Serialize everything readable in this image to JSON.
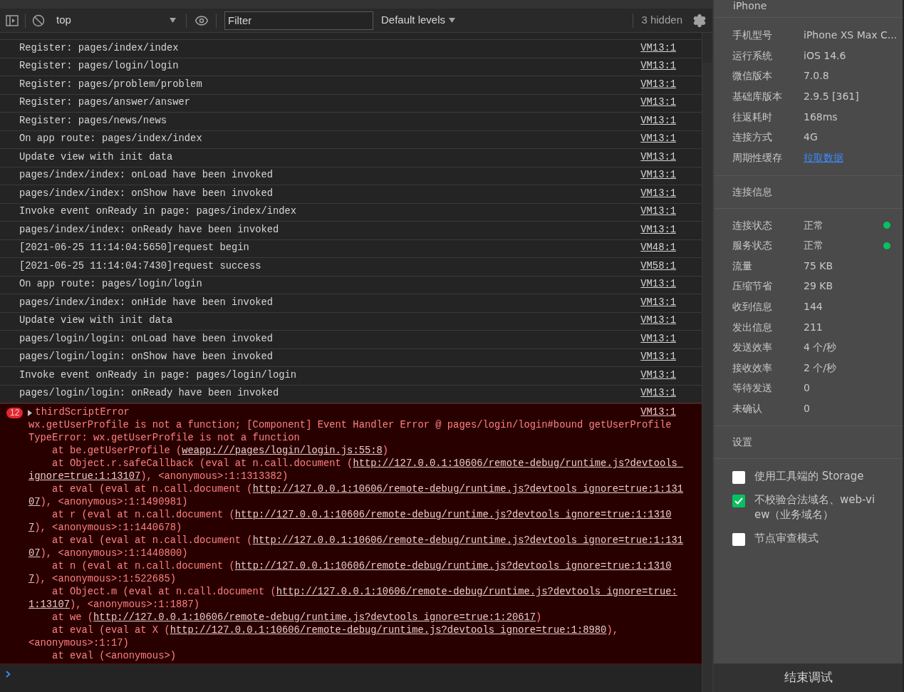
{
  "toolbar": {
    "context": "top",
    "filter": {
      "placeholder": "Filter"
    },
    "levels": "Default levels",
    "hidden": "3 hidden"
  },
  "logs": [
    {
      "text": "Register: pages/index/index",
      "source": "VM13:1"
    },
    {
      "text": "Register: pages/login/login",
      "source": "VM13:1"
    },
    {
      "text": "Register: pages/problem/problem",
      "source": "VM13:1"
    },
    {
      "text": "Register: pages/answer/answer",
      "source": "VM13:1"
    },
    {
      "text": "Register: pages/news/news",
      "source": "VM13:1"
    },
    {
      "text": "On app route: pages/index/index",
      "source": "VM13:1"
    },
    {
      "text": "Update view with init data",
      "source": "VM13:1"
    },
    {
      "text": "pages/index/index: onLoad have been invoked",
      "source": "VM13:1"
    },
    {
      "text": "pages/index/index: onShow have been invoked",
      "source": "VM13:1"
    },
    {
      "text": "Invoke event onReady in page: pages/index/index",
      "source": "VM13:1"
    },
    {
      "text": "pages/index/index: onReady have been invoked",
      "source": "VM13:1"
    },
    {
      "text": "[2021-06-25 11:14:04:5650]request begin",
      "source": "VM48:1"
    },
    {
      "text": "[2021-06-25 11:14:04:7430]request success",
      "source": "VM58:1"
    },
    {
      "text": "On app route: pages/login/login",
      "source": "VM13:1"
    },
    {
      "text": "pages/index/index: onHide have been invoked",
      "source": "VM13:1"
    },
    {
      "text": "Update view with init data",
      "source": "VM13:1"
    },
    {
      "text": "pages/login/login: onLoad have been invoked",
      "source": "VM13:1"
    },
    {
      "text": "pages/login/login: onShow have been invoked",
      "source": "VM13:1"
    },
    {
      "text": "Invoke event onReady in page: pages/login/login",
      "source": "VM13:1"
    },
    {
      "text": "pages/login/login: onReady have been invoked",
      "source": "VM13:1"
    }
  ],
  "error": {
    "count": "12",
    "title": "thirdScriptError",
    "source": "VM13:1",
    "lines": [
      [
        {
          "text": "wx.getUserProfile is not a function; [Component] Event Handler Error @ pages/login/login#bound getUserProfile",
          "link": false
        }
      ],
      [
        {
          "text": "TypeError: wx.getUserProfile is not a function",
          "link": false
        }
      ],
      [
        {
          "text": "    at be.getUserProfile (",
          "link": false
        },
        {
          "text": "weapp:///pages/login/login.js:55:8",
          "link": true
        },
        {
          "text": ")",
          "link": false
        }
      ],
      [
        {
          "text": "    at Object.r.safeCallback (eval at n.call.document (",
          "link": false
        },
        {
          "text": "http://127.0.0.1:10606/remote-debug/runtime.js?devtools_",
          "link": true
        }
      ],
      [
        {
          "text": "ignore=true:1:13107",
          "link": true
        },
        {
          "text": "), <anonymous>:1:1313382)",
          "link": false
        }
      ],
      [
        {
          "text": "    at eval (eval at n.call.document (",
          "link": false
        },
        {
          "text": "http://127.0.0.1:10606/remote-debug/runtime.js?devtools_ignore=true:1:131",
          "link": true
        }
      ],
      [
        {
          "text": "07",
          "link": true
        },
        {
          "text": "), <anonymous>:1:1490981)",
          "link": false
        }
      ],
      [
        {
          "text": "    at r (eval at n.call.document (",
          "link": false
        },
        {
          "text": "http://127.0.0.1:10606/remote-debug/runtime.js?devtools_ignore=true:1:1310",
          "link": true
        }
      ],
      [
        {
          "text": "7",
          "link": true
        },
        {
          "text": "), <anonymous>:1:1440678)",
          "link": false
        }
      ],
      [
        {
          "text": "    at eval (eval at n.call.document (",
          "link": false
        },
        {
          "text": "http://127.0.0.1:10606/remote-debug/runtime.js?devtools_ignore=true:1:131",
          "link": true
        }
      ],
      [
        {
          "text": "07",
          "link": true
        },
        {
          "text": "), <anonymous>:1:1440800)",
          "link": false
        }
      ],
      [
        {
          "text": "    at n (eval at n.call.document (",
          "link": false
        },
        {
          "text": "http://127.0.0.1:10606/remote-debug/runtime.js?devtools_ignore=true:1:1310",
          "link": true
        }
      ],
      [
        {
          "text": "7",
          "link": true
        },
        {
          "text": "), <anonymous>:1:522685)",
          "link": false
        }
      ],
      [
        {
          "text": "    at Object.m (eval at n.call.document (",
          "link": false
        },
        {
          "text": "http://127.0.0.1:10606/remote-debug/runtime.js?devtools_ignore=true:",
          "link": true
        }
      ],
      [
        {
          "text": "1:13107",
          "link": true
        },
        {
          "text": "), <anonymous>:1:1887)",
          "link": false
        }
      ],
      [
        {
          "text": "    at we (",
          "link": false
        },
        {
          "text": "http://127.0.0.1:10606/remote-debug/runtime.js?devtools_ignore=true:1:20617",
          "link": true
        },
        {
          "text": ")",
          "link": false
        }
      ],
      [
        {
          "text": "    at eval (eval at X (",
          "link": false
        },
        {
          "text": "http://127.0.0.1:10606/remote-debug/runtime.js?devtools_ignore=true:1:8980",
          "link": true
        },
        {
          "text": "),",
          "link": false
        }
      ],
      [
        {
          "text": "<anonymous>:1:17)",
          "link": false
        }
      ],
      [
        {
          "text": "    at eval (<anonymous>)",
          "link": false
        }
      ]
    ]
  },
  "device": {
    "title": "iPhone",
    "info": [
      {
        "label": "手机型号",
        "value": "iPhone XS Max C...",
        "kind": "text"
      },
      {
        "label": "运行系统",
        "value": "iOS 14.6",
        "kind": "text"
      },
      {
        "label": "微信版本",
        "value": "7.0.8",
        "kind": "text"
      },
      {
        "label": "基础库版本",
        "value": "2.9.5 [361]",
        "kind": "text"
      },
      {
        "label": "往返耗时",
        "value": "168ms",
        "kind": "text"
      },
      {
        "label": "连接方式",
        "value": "4G",
        "kind": "text"
      },
      {
        "label": "周期性缓存",
        "value": "拉取数据",
        "kind": "link"
      }
    ]
  },
  "connection": {
    "title": "连接信息",
    "rows": [
      {
        "label": "连接状态",
        "value": "正常",
        "color": "#07c160"
      },
      {
        "label": "服务状态",
        "value": "正常",
        "color": "#07c160"
      },
      {
        "label": "流量",
        "value": "75 KB"
      },
      {
        "label": "压缩节省",
        "value": "29 KB"
      },
      {
        "label": "收到信息",
        "value": "144"
      },
      {
        "label": "发出信息",
        "value": "211"
      },
      {
        "label": "发送效率",
        "value": "4 个/秒"
      },
      {
        "label": "接收效率",
        "value": "2 个/秒"
      },
      {
        "label": "等待发送",
        "value": "0"
      },
      {
        "label": "未确认",
        "value": "0"
      }
    ]
  },
  "settings": {
    "title": "设置",
    "options": [
      {
        "label": "使用工具端的 Storage",
        "checked": false
      },
      {
        "label": "不校验合法域名、web-view（业务域名）",
        "checked": true
      },
      {
        "label": "节点审查模式",
        "checked": false
      }
    ]
  },
  "end_button": "结束调试"
}
